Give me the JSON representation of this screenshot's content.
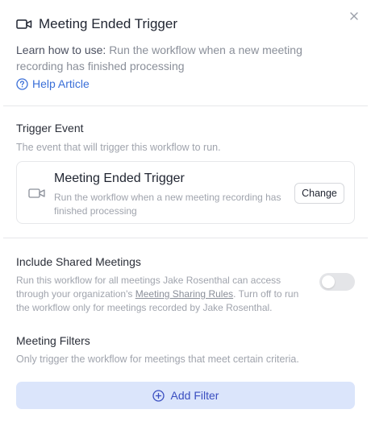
{
  "colors": {
    "link": "#3a6fd8",
    "add_filter_bg": "#dbe5fb",
    "add_filter_text": "#3a4ec0",
    "toggle_off": "#e4e5e8"
  },
  "icons": {
    "header": "video-camera-icon",
    "help": "question-circle-icon",
    "card": "video-camera-icon",
    "add_filter": "plus-circle-icon",
    "close": "close-icon"
  },
  "header": {
    "title": "Meeting Ended Trigger"
  },
  "learn": {
    "label": "Learn how to use:",
    "text": "Run the workflow when a new meeting recording has finished processing"
  },
  "help": {
    "label": "Help Article"
  },
  "trigger_event": {
    "title": "Trigger Event",
    "description": "The event that will trigger this workflow to run.",
    "card_title": "Meeting Ended Trigger",
    "card_description": "Run the workflow when a new meeting recording has finished processing",
    "change_label": "Change"
  },
  "shared_meetings": {
    "title": "Include Shared Meetings",
    "desc_part1": "Run this workflow for all meetings Jake Rosenthal can access through your organization's ",
    "link_text": "Meeting Sharing Rules",
    "desc_part2": ". Turn off to run the workflow only for meetings recorded by Jake Rosenthal.",
    "toggle_on": false
  },
  "meeting_filters": {
    "title": "Meeting Filters",
    "description": "Only trigger the workflow for meetings that meet certain criteria.",
    "add_filter_label": "Add Filter"
  }
}
